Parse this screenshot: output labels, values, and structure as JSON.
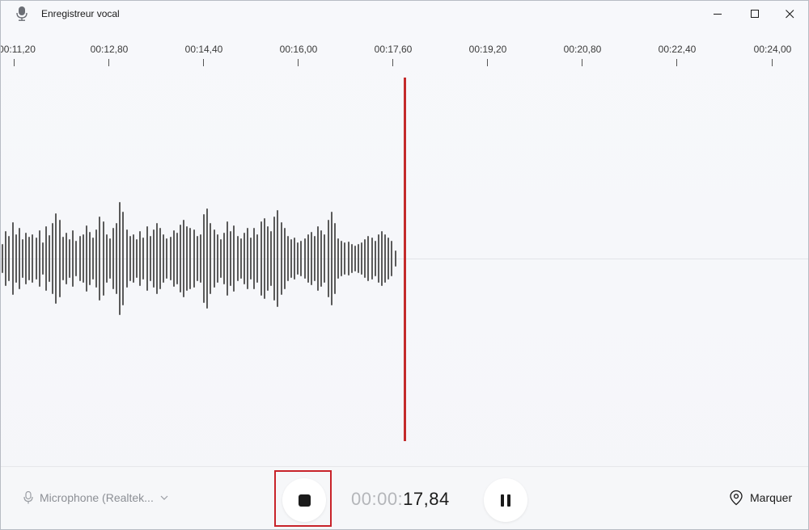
{
  "app": {
    "title": "Enregistreur vocal",
    "icon": "microphone-icon"
  },
  "window_controls": {
    "minimize": "minimize-icon",
    "maximize": "maximize-icon",
    "close": "close-icon"
  },
  "ruler": {
    "labels": [
      "00:11,20",
      "00:12,80",
      "00:14,40",
      "00:16,00",
      "00:17,60",
      "00:19,20",
      "00:20,80",
      "00:22,40",
      "00:24,00"
    ]
  },
  "bottom": {
    "microphone_label": "Microphone (Realtek...",
    "timer_dim": "00:00:",
    "timer_bright": "17,84",
    "mark_label": "Marquer"
  },
  "colors": {
    "playhead": "#c42b2b",
    "waveform": "#5a5a5a",
    "highlight": "#c8232a"
  }
}
